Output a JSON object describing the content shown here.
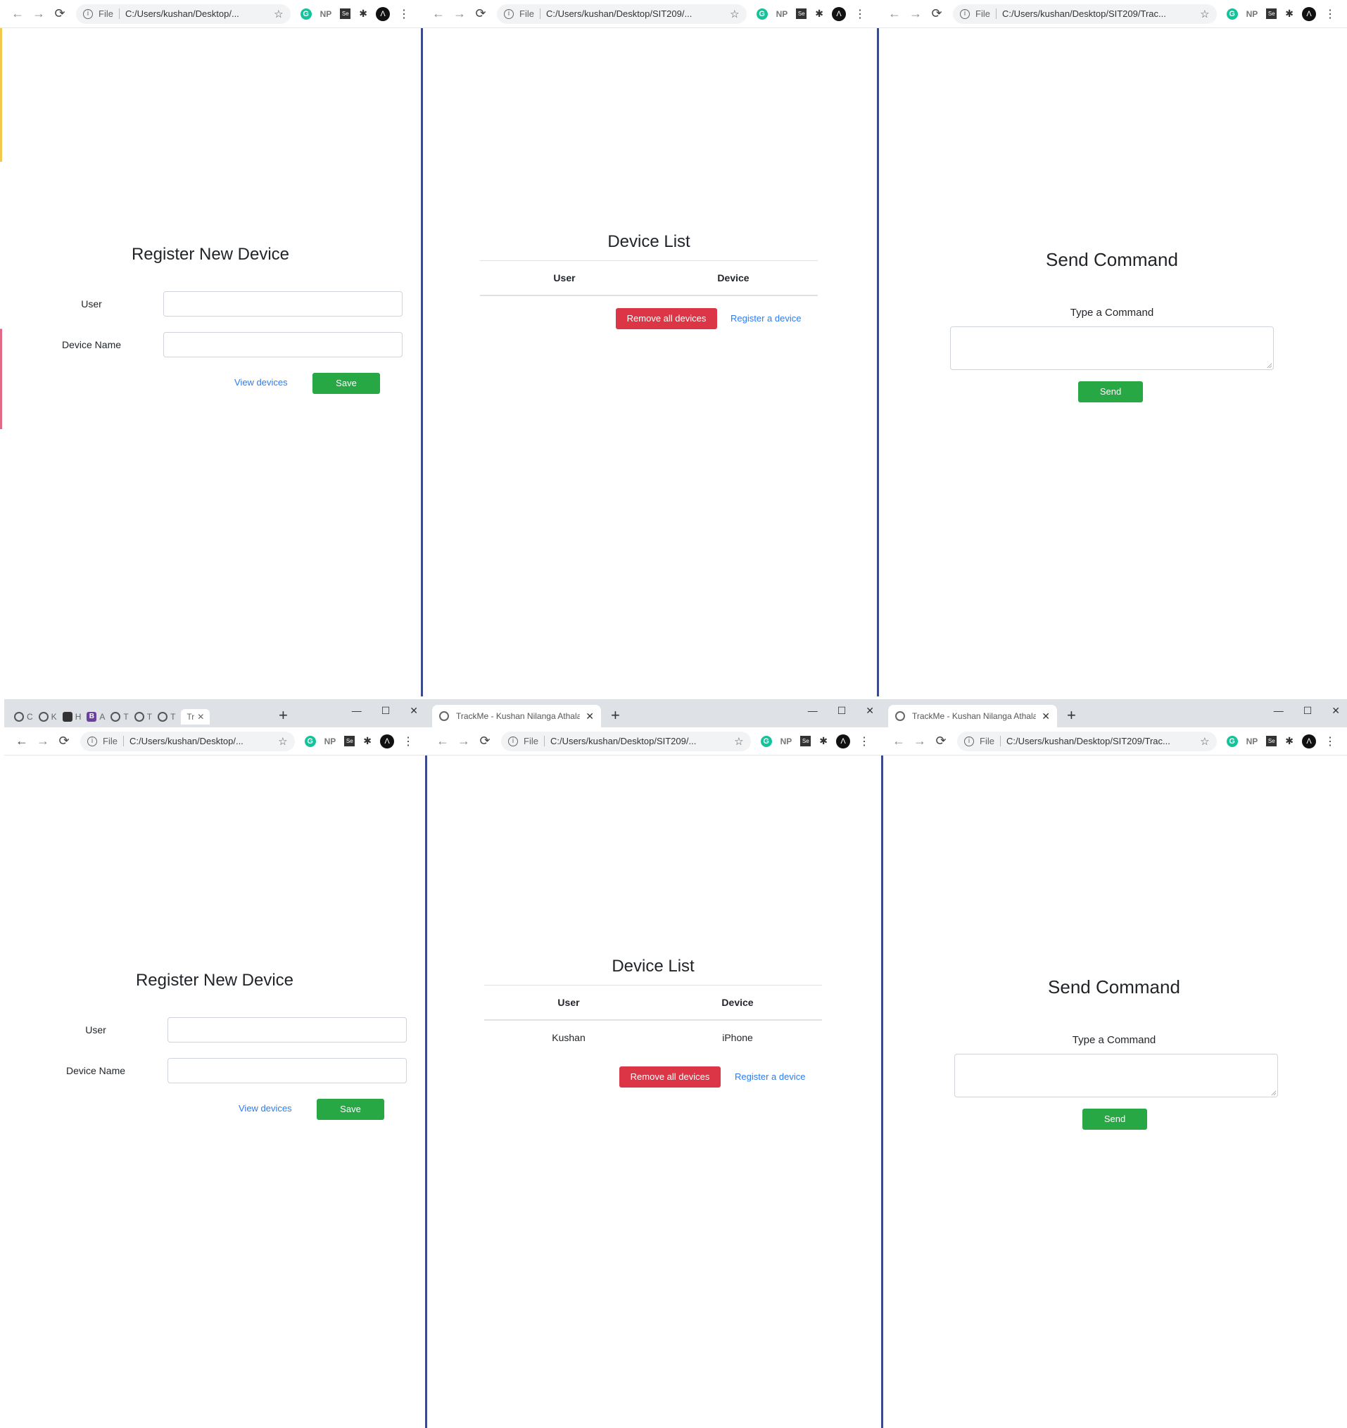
{
  "browser": {
    "scheme": "File",
    "url_short_1": "C:/Users/kushan/Desktop/...",
    "url_short_2": "C:/Users/kushan/Desktop/SIT209/...",
    "url_short_3": "C:/Users/kushan/Desktop/SIT209/Trac...",
    "tab_title": "TrackMe - Kushan Nilanga Athala",
    "ext_np": "NP",
    "ext_g": "G",
    "ext_se": "Se",
    "nav_back": "←",
    "nav_forward": "→",
    "nav_reload": "⟳",
    "star": "☆",
    "puzzle": "✱",
    "menu": "⋮",
    "new_tab": "+",
    "close": "✕",
    "minimize": "—",
    "maximize": "☐",
    "mini_tabs": [
      "C",
      "K",
      "H",
      "A",
      "T",
      "T",
      "T",
      "Tr"
    ]
  },
  "register": {
    "title": "Register New Device",
    "user_label": "User",
    "device_label": "Device Name",
    "view_link": "View devices",
    "save_button": "Save"
  },
  "device_list": {
    "title": "Device List",
    "columns": [
      "User",
      "Device"
    ],
    "rows": [
      [
        "Kushan",
        "iPhone"
      ]
    ],
    "remove_button": "Remove all devices",
    "register_link": "Register a device"
  },
  "command": {
    "title": "Send Command",
    "label": "Type a Command",
    "send_button": "Send"
  },
  "colors": {
    "success": "#28a745",
    "danger": "#dc3545",
    "link": "#2a7cf4"
  }
}
